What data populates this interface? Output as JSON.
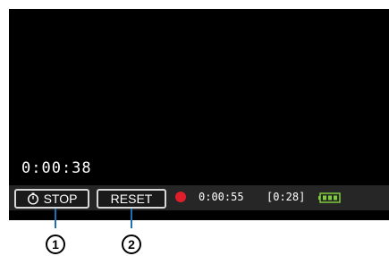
{
  "osd": {
    "elapsed_time": "0:00:38",
    "stop_label": "STOP",
    "stop_icon": "timer-icon",
    "reset_label": "RESET",
    "record_indicator": "rec-dot-icon",
    "record_color": "#e01e2b",
    "recording_time": "0:00:55",
    "remaining_time": "[0:28]",
    "battery_icon": "battery-icon",
    "battery_color": "#7fcc3a"
  },
  "callouts": {
    "stop_number": "1",
    "reset_number": "2"
  },
  "colors": {
    "screen": "#000000",
    "bar": "#262626",
    "callout_line": "#1e6fb5"
  }
}
